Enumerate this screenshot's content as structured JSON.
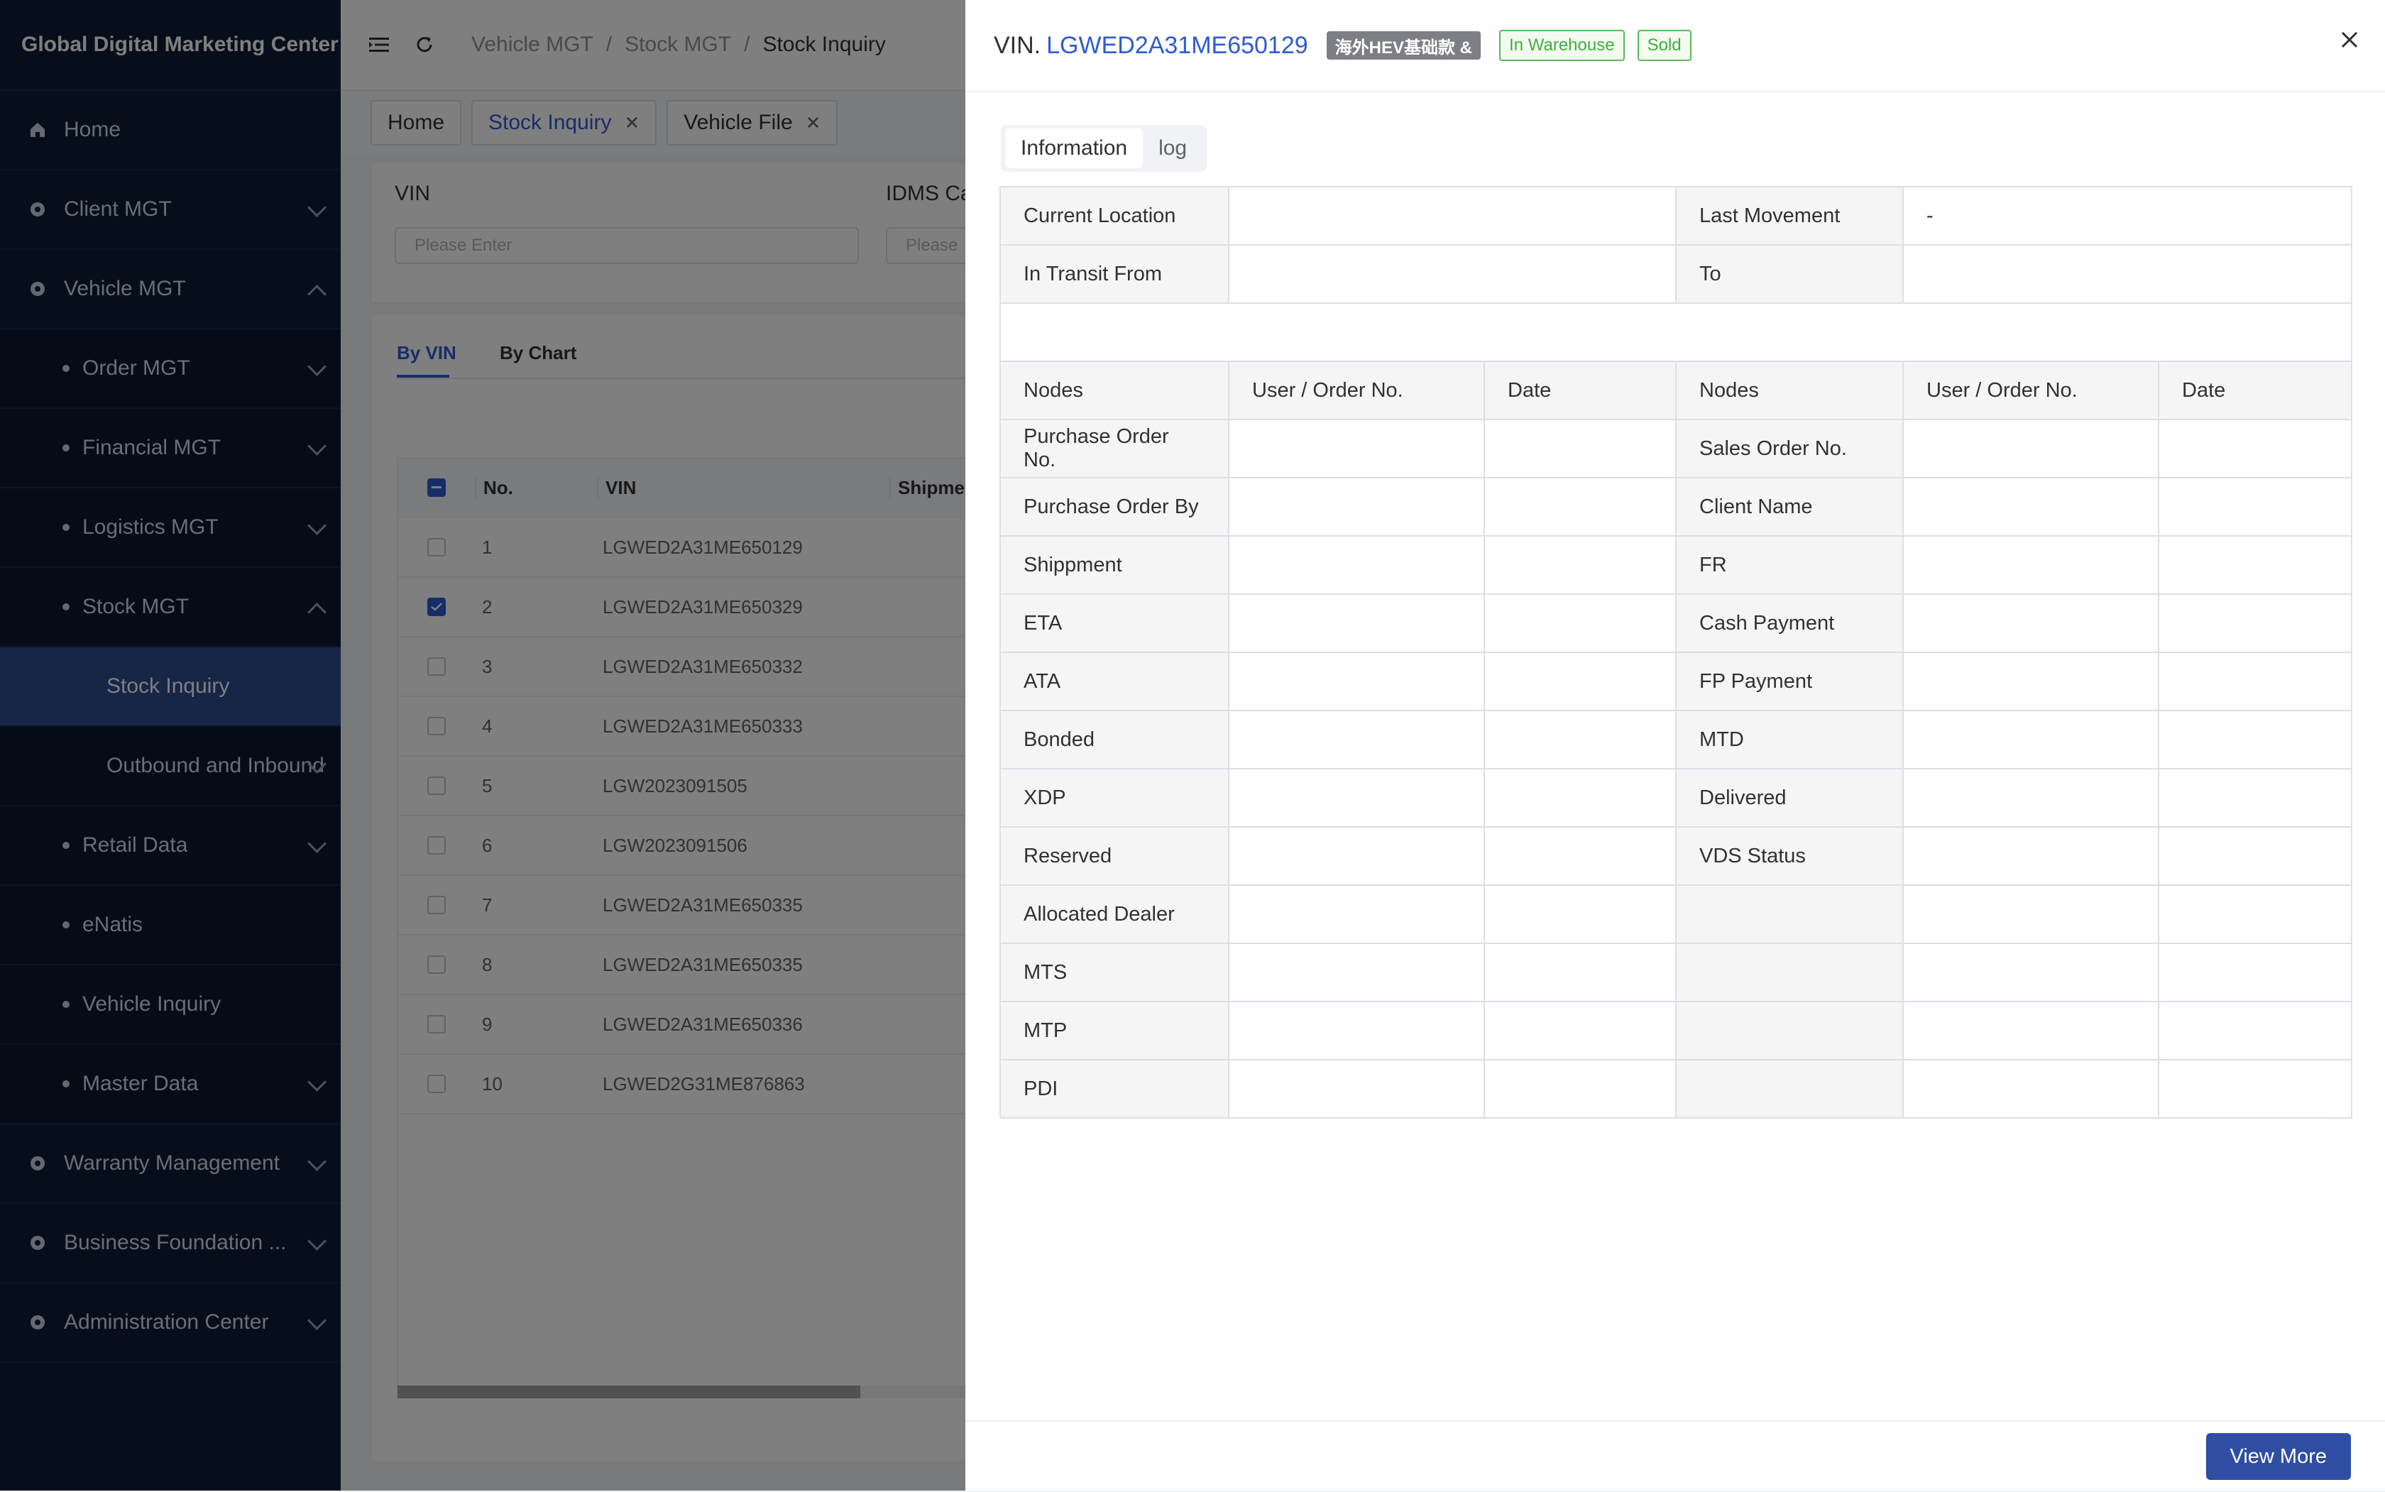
{
  "sidebar": {
    "brand": "Global Digital Marketing Center",
    "items": [
      {
        "label": "Home"
      },
      {
        "label": "Client MGT"
      },
      {
        "label": "Vehicle MGT"
      },
      {
        "label": "Order MGT"
      },
      {
        "label": "Financial MGT"
      },
      {
        "label": "Logistics MGT"
      },
      {
        "label": "Stock MGT"
      },
      {
        "label": "Stock Inquiry"
      },
      {
        "label": "Outbound and Inbound"
      },
      {
        "label": "Retail Data"
      },
      {
        "label": "eNatis"
      },
      {
        "label": "Vehicle Inquiry"
      },
      {
        "label": "Master Data"
      },
      {
        "label": "Warranty Management"
      },
      {
        "label": "Business Foundation ..."
      },
      {
        "label": "Administration Center"
      }
    ]
  },
  "topbar": {
    "breadcrumbs": [
      "Vehicle MGT",
      "Stock MGT",
      "Stock Inquiry"
    ],
    "separator": "/"
  },
  "tabs": [
    {
      "label": "Home"
    },
    {
      "label": "Stock Inquiry"
    },
    {
      "label": "Vehicle File"
    }
  ],
  "filters": {
    "vin_label": "VIN",
    "vin_placeholder": "Please Enter",
    "idms_label": "IDMS Ca",
    "idms_placeholder": "Please"
  },
  "list": {
    "tab_by_vin": "By VIN",
    "tab_by_chart": "By Chart",
    "columns": [
      "No.",
      "VIN",
      "Shipment"
    ],
    "rows": [
      {
        "no": "1",
        "vin": "LGWED2A31ME650129",
        "checked": false
      },
      {
        "no": "2",
        "vin": "LGWED2A31ME650329",
        "checked": true
      },
      {
        "no": "3",
        "vin": "LGWED2A31ME650332",
        "checked": false
      },
      {
        "no": "4",
        "vin": "LGWED2A31ME650333",
        "checked": false
      },
      {
        "no": "5",
        "vin": "LGW2023091505",
        "checked": false
      },
      {
        "no": "6",
        "vin": "LGW2023091506",
        "checked": false
      },
      {
        "no": "7",
        "vin": "LGWED2A31ME650335",
        "checked": false
      },
      {
        "no": "8",
        "vin": "LGWED2A31ME650335",
        "checked": false
      },
      {
        "no": "9",
        "vin": "LGWED2A31ME650336",
        "checked": false
      },
      {
        "no": "10",
        "vin": "LGWED2G31ME876863",
        "checked": false
      }
    ]
  },
  "drawer": {
    "vin_prefix": "VIN.",
    "vin": "LGWED2A31ME650129",
    "badge_model": "海外HEV基础款 &",
    "badge_status": "In Warehouse",
    "badge_sold": "Sold",
    "seg_info": "Information",
    "seg_log": "log",
    "current_location_label": "Current Location",
    "current_location_value": "",
    "last_movement_label": "Last Movement",
    "last_movement_value": "-",
    "in_transit_label": "In Transit From",
    "in_transit_value": "",
    "to_label": "To",
    "to_value": "",
    "headers": {
      "nodes": "Nodes",
      "user_order": "User / Order No.",
      "date": "Date"
    },
    "left_nodes": [
      "Purchase Order No.",
      "Purchase Order By",
      "Shippment",
      "ETA",
      "ATA",
      "Bonded",
      "XDP",
      "Reserved",
      "Allocated Dealer",
      "MTS",
      "MTP",
      "PDI"
    ],
    "right_nodes": [
      "Sales Order No.",
      "Client Name",
      "FR",
      "Cash Payment",
      "FP Payment",
      "MTD",
      "Delivered",
      "VDS Status",
      "",
      "",
      "",
      ""
    ],
    "view_more": "View More"
  },
  "colors": {
    "sidebar_bg": "#0f1d36",
    "sidebar_active": "#2f4d8f",
    "accent": "#2f5bd3",
    "success": "#3fae3f",
    "primary_button": "#2f4ea3"
  }
}
